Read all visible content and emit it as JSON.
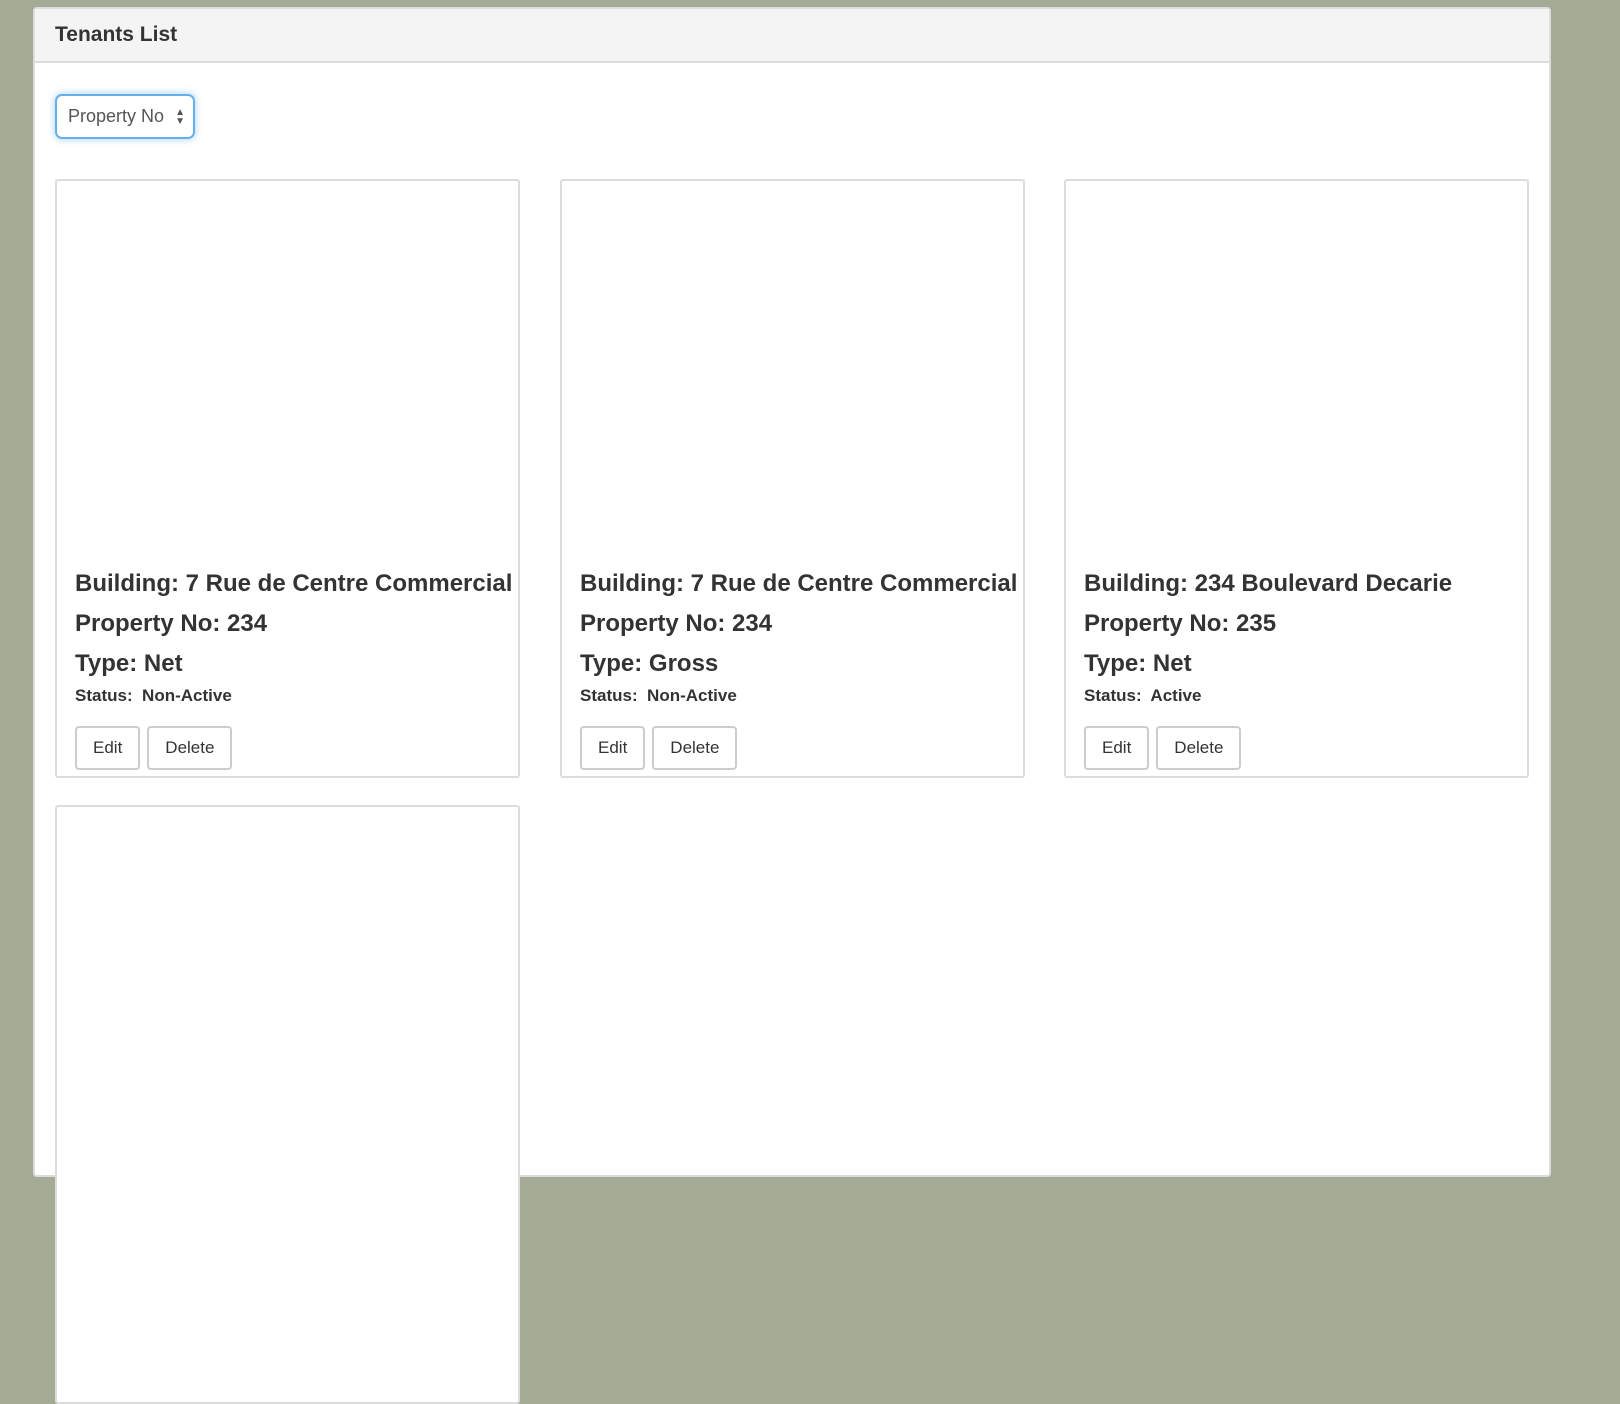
{
  "panel": {
    "title": "Tenants List"
  },
  "filter": {
    "selected": "Property No"
  },
  "tenants": [
    {
      "building": "Building: 7 Rue de Centre Commercial",
      "property": "Property No: 234",
      "type": "Type: Net",
      "status": "Status:  Non-Active",
      "edit": "Edit",
      "delete": "Delete"
    },
    {
      "building": "Building: 7 Rue de Centre Commercial",
      "property": "Property No: 234",
      "type": "Type: Gross",
      "status": "Status:  Non-Active",
      "edit": "Edit",
      "delete": "Delete"
    },
    {
      "building": "Building: 234 Boulevard Decarie",
      "property": "Property No: 235",
      "type": "Type: Net",
      "status": "Status:  Active",
      "edit": "Edit",
      "delete": "Delete"
    }
  ]
}
